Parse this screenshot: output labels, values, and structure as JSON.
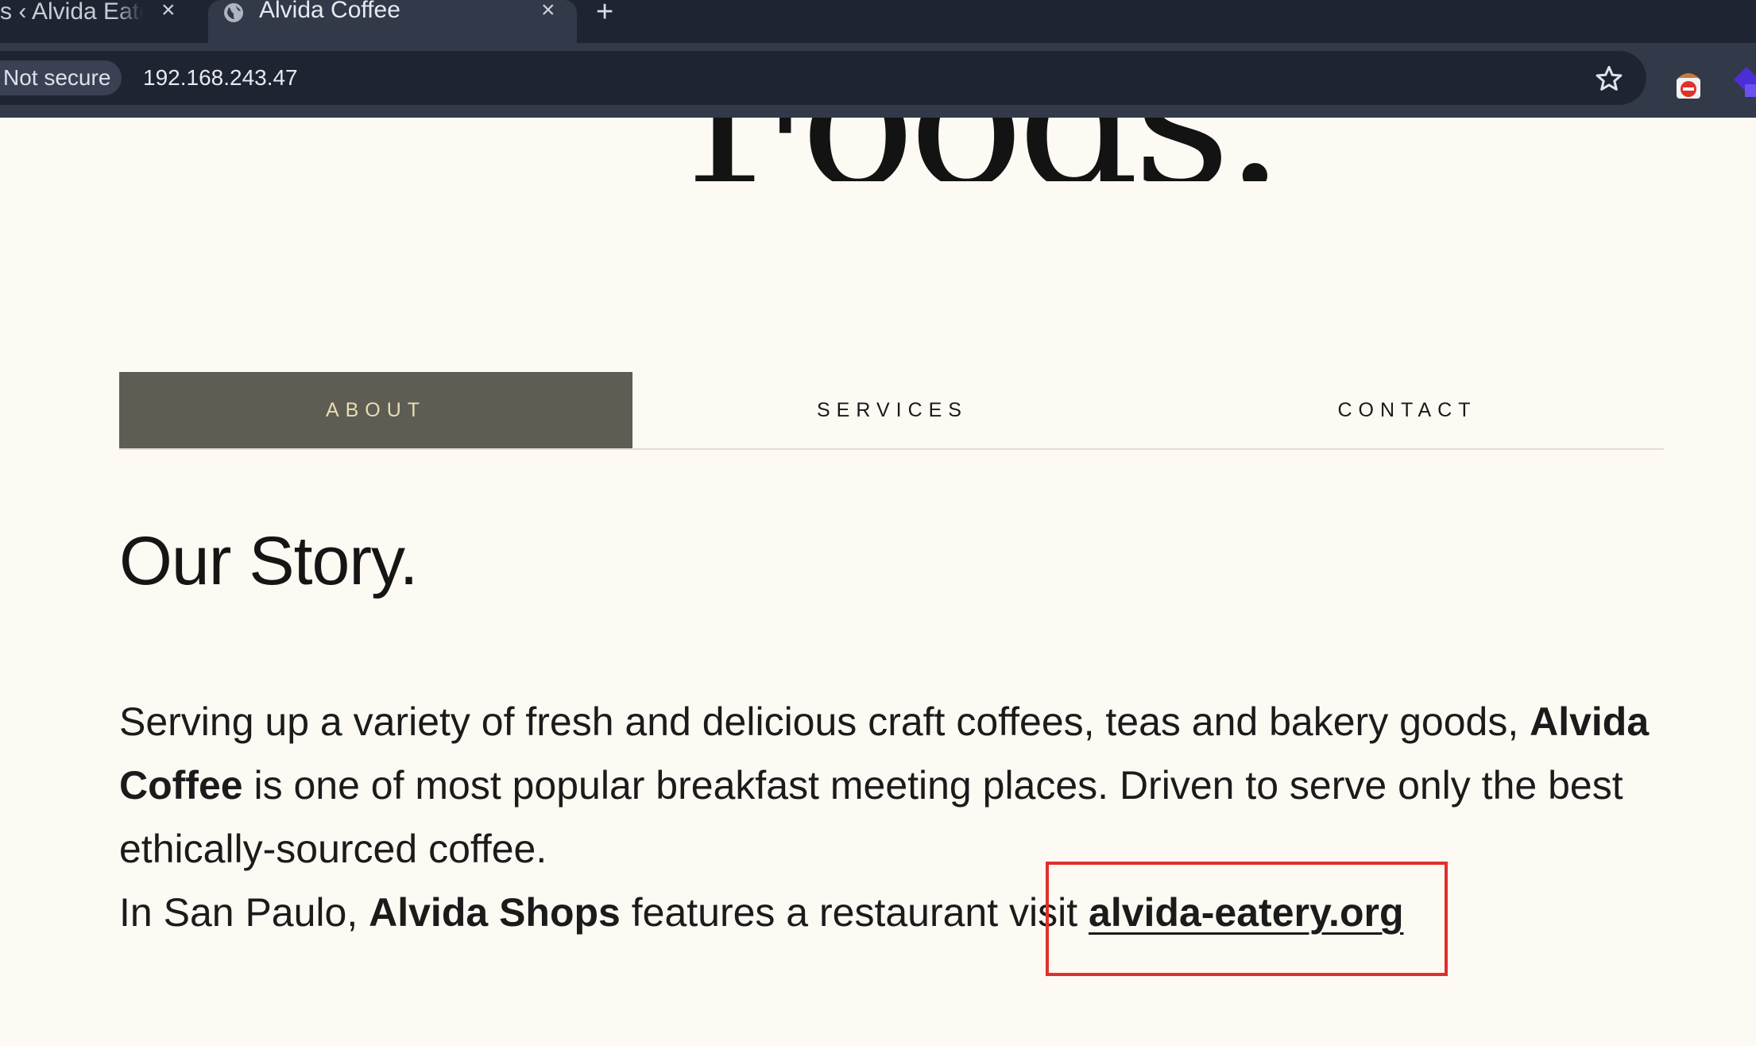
{
  "browser": {
    "tabs": [
      {
        "title": "s ‹ Alvida Eater",
        "close": "×",
        "active": false
      },
      {
        "title": "Alvida Coffee",
        "close": "×",
        "active": true
      }
    ],
    "new_tab": "+",
    "security_label": "Not secure",
    "url": "192.168.243.47",
    "icons": [
      "globe-icon",
      "star-icon",
      "extension-icon",
      "extension-icon"
    ]
  },
  "page": {
    "hero_fragment": "Foods.",
    "nav_tabs": [
      "ABOUT",
      "SERVICES",
      "CONTACT"
    ],
    "active_tab": "ABOUT",
    "heading": "Our Story.",
    "paragraph": {
      "line1_a": "Serving up a variety of fresh and delicious craft coffees, teas and bakery goods, ",
      "line1_b": "Alvida",
      "line2_a": "Coffee",
      "line2_b": " is one of most popular breakfast meeting places. Driven to serve only the best",
      "line3": "ethically-sourced coffee.",
      "line4_a": "In San Paulo, ",
      "line4_b": "Alvida Shops",
      "line4_c": " features a restaurant visit ",
      "link": "alvida-eatery.org"
    }
  },
  "colors": {
    "page_bg": "#fdf9f3",
    "active_tab_bg": "#5d5d53",
    "active_tab_text": "#e9dcb5",
    "highlight": "#e0302a"
  }
}
